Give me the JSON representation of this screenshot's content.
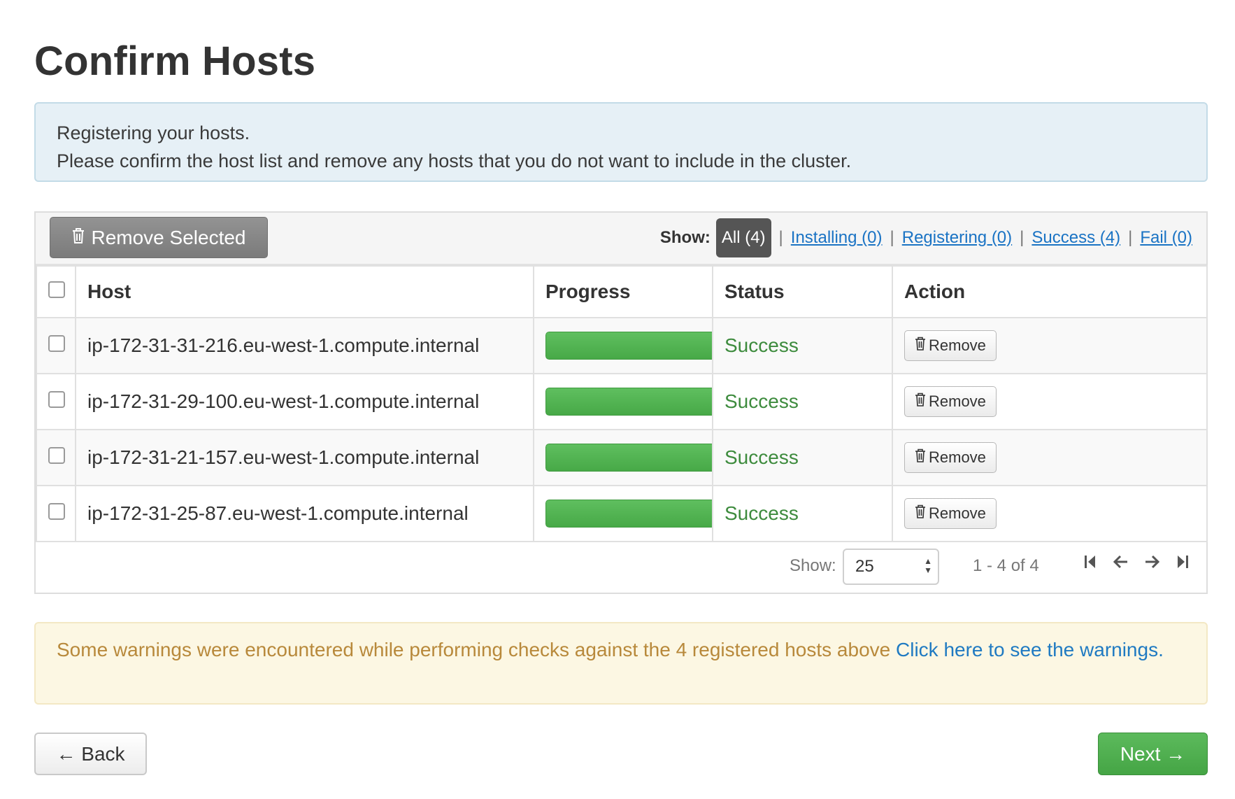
{
  "page": {
    "title": "Confirm Hosts",
    "info": {
      "line1": "Registering your hosts.",
      "line2": "Please confirm the host list and remove any hosts that you do not want to include in the cluster."
    }
  },
  "toolbar": {
    "remove_selected_label": "Remove Selected",
    "trash_icon": "trash-icon",
    "show_label": "Show:",
    "filters": [
      {
        "label": "All (4)",
        "active": true
      },
      {
        "label": "Installing (0)",
        "active": false
      },
      {
        "label": "Registering (0)",
        "active": false
      },
      {
        "label": "Success (4)",
        "active": false
      },
      {
        "label": "Fail (0)",
        "active": false
      }
    ],
    "separator": "|"
  },
  "table": {
    "columns": [
      "Host",
      "Progress",
      "Status",
      "Action"
    ],
    "rows": [
      {
        "host": "ip-172-31-31-216.eu-west-1.compute.internal",
        "progress": 100,
        "status": "Success",
        "action": "Remove"
      },
      {
        "host": "ip-172-31-29-100.eu-west-1.compute.internal",
        "progress": 100,
        "status": "Success",
        "action": "Remove"
      },
      {
        "host": "ip-172-31-21-157.eu-west-1.compute.internal",
        "progress": 100,
        "status": "Success",
        "action": "Remove"
      },
      {
        "host": "ip-172-31-25-87.eu-west-1.compute.internal",
        "progress": 100,
        "status": "Success",
        "action": "Remove"
      }
    ]
  },
  "pager": {
    "show_label": "Show:",
    "page_size": "25",
    "range": "1 - 4 of 4",
    "icons": [
      "first-page-icon",
      "prev-page-icon",
      "next-page-icon",
      "last-page-icon"
    ]
  },
  "warning": {
    "text": "Some warnings were encountered while performing checks against the 4 registered hosts above ",
    "link": "Click here to see the warnings."
  },
  "nav": {
    "back_label": "← Back",
    "next_label": "Next →"
  },
  "colors": {
    "success": "#3d8b3d",
    "progress_bar": "#4cae4c",
    "link": "#1a73c4",
    "warning_text": "#b8893b",
    "next_button": "#4cae4c"
  }
}
